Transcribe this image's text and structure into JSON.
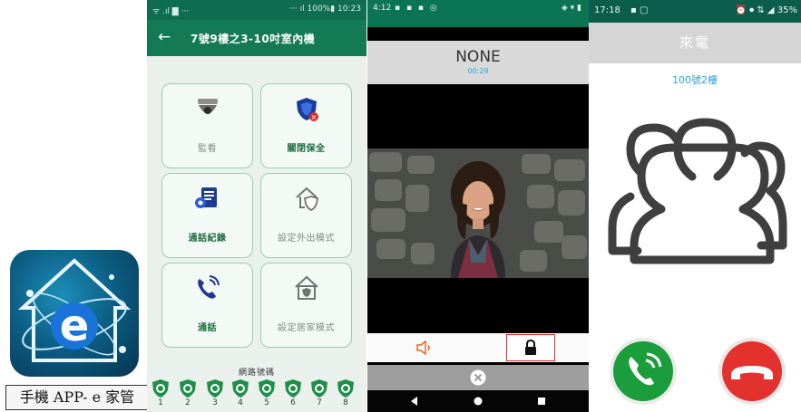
{
  "app_panel": {
    "caption": "手機 APP- e 家管",
    "icon": "e-home-logo-icon"
  },
  "screen1": {
    "status_bar": {
      "left": "ᯤ .ıl ▇ ···",
      "right": "··· ıl 100%▮ 10:23"
    },
    "title": "7號9樓之3-10吋室內機",
    "back_icon": "arrow-left-icon",
    "tiles": [
      {
        "label": "監看",
        "icon": "dome-camera-icon",
        "state": "disabled"
      },
      {
        "label": "關閉保全",
        "icon": "shield-alert-icon",
        "state": "enabled"
      },
      {
        "label": "通話紀錄",
        "icon": "call-log-icon",
        "state": "enabled"
      },
      {
        "label": "設定外出模式",
        "icon": "shield-house-icon",
        "state": "disabled"
      },
      {
        "label": "通話",
        "icon": "phone-ringing-icon",
        "state": "enabled"
      },
      {
        "label": "設定居家模式",
        "icon": "house-shield-icon",
        "state": "disabled"
      }
    ],
    "network_label": "網路號碼",
    "numbers": [
      "1",
      "2",
      "3",
      "4",
      "5",
      "6",
      "7",
      "8"
    ]
  },
  "screen2": {
    "status_bar": {
      "time": "4:12",
      "right": "◈ ▾ ▮"
    },
    "caller_name": "NONE",
    "timer": "00:29",
    "speaker_icon": "speaker-icon",
    "lock_icon": "lock-icon",
    "cancel_icon": "close-circle-icon",
    "photo_icon": "video-feed-image"
  },
  "screen3": {
    "status_bar": {
      "time": "17:18",
      "right": "⏰ ⏺ ⇅ ◢ 35%"
    },
    "title": "來電",
    "caller": "100號2樓",
    "people_icon": "group-people-icon",
    "answer_icon": "answer-call-icon",
    "decline_icon": "decline-call-icon"
  },
  "colors": {
    "green_dark": "#0f6e4f",
    "green_appbar": "#137a55",
    "accent_blue": "#29a7d8",
    "decline_red": "#e3322e",
    "answer_green": "#1a9d3a",
    "highlight_red": "#d9302c"
  }
}
